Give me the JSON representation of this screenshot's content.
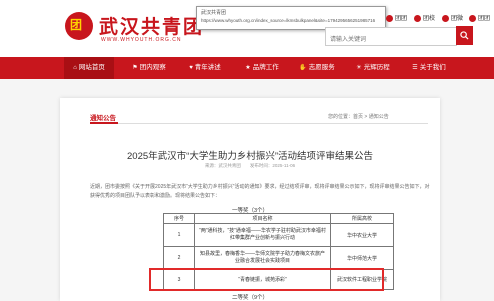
{
  "header": {
    "logo_mark": "团",
    "logo_text": "武汉共青团",
    "logo_url": "WWW.WHYOUTH.ORG.CN",
    "tooltip_title": "武汉共青团",
    "tooltip_url": "https://www.whyouth.org.cn/index_source=lkmsbulkpanel&site=1794295656251985716",
    "top_links": [
      {
        "label": "团团"
      },
      {
        "label": "团校"
      },
      {
        "label": "团微"
      },
      {
        "label": "团团"
      }
    ]
  },
  "search": {
    "placeholder": "请输入关键词"
  },
  "nav": {
    "items": [
      {
        "label": "网站首页",
        "icon": "home-icon",
        "active": true
      },
      {
        "label": "团内观察",
        "icon": "flag-icon"
      },
      {
        "label": "青年讲述",
        "icon": "heart-icon"
      },
      {
        "label": "品牌工作",
        "icon": "star-icon"
      },
      {
        "label": "志愿服务",
        "icon": "hand-icon"
      },
      {
        "label": "光辉历程",
        "icon": "light-icon"
      },
      {
        "label": "关于我们",
        "icon": "info-icon"
      }
    ]
  },
  "section": {
    "title": "通知公告",
    "breadcrumb": "您的位置：首页 > 通知公告"
  },
  "article": {
    "title": "2025年武汉市“大学生助力乡村振兴”活动结项评审结果公告",
    "meta": "来源：武汉共青团　　发布时间：2025-11-06",
    "paragraph": "近期，团市委按照《关于开展2025年武汉市“大学生助力乡村振兴”活动的通知》要求，经过结项评审，现将评审结果公示如下，现将评审结果公告如下，对获得优秀的项目团队予以表彰和激励。现将结果公告如下："
  },
  "table": {
    "group1_title": "一等奖（3个）",
    "group2_title": "二等奖（9个）",
    "headers": [
      "序号",
      "项目名称",
      "所属高校"
    ],
    "rows": [
      {
        "no": "1",
        "name": "“两”通科技，“技”通幸福——华农学子驻村助武汉市幸福村红带集群产业创新与振兴行动",
        "school": "华中农业大学"
      },
      {
        "no": "2",
        "name": "知县故里，春梅香华——华师文院学子助力春梅文农旅产业融合发展社会实践项目",
        "school": "华中师范大学"
      },
      {
        "no": "3",
        "name": "“青春链振，城苑添彩”",
        "school": "武汉软件工程职业学院"
      }
    ]
  }
}
